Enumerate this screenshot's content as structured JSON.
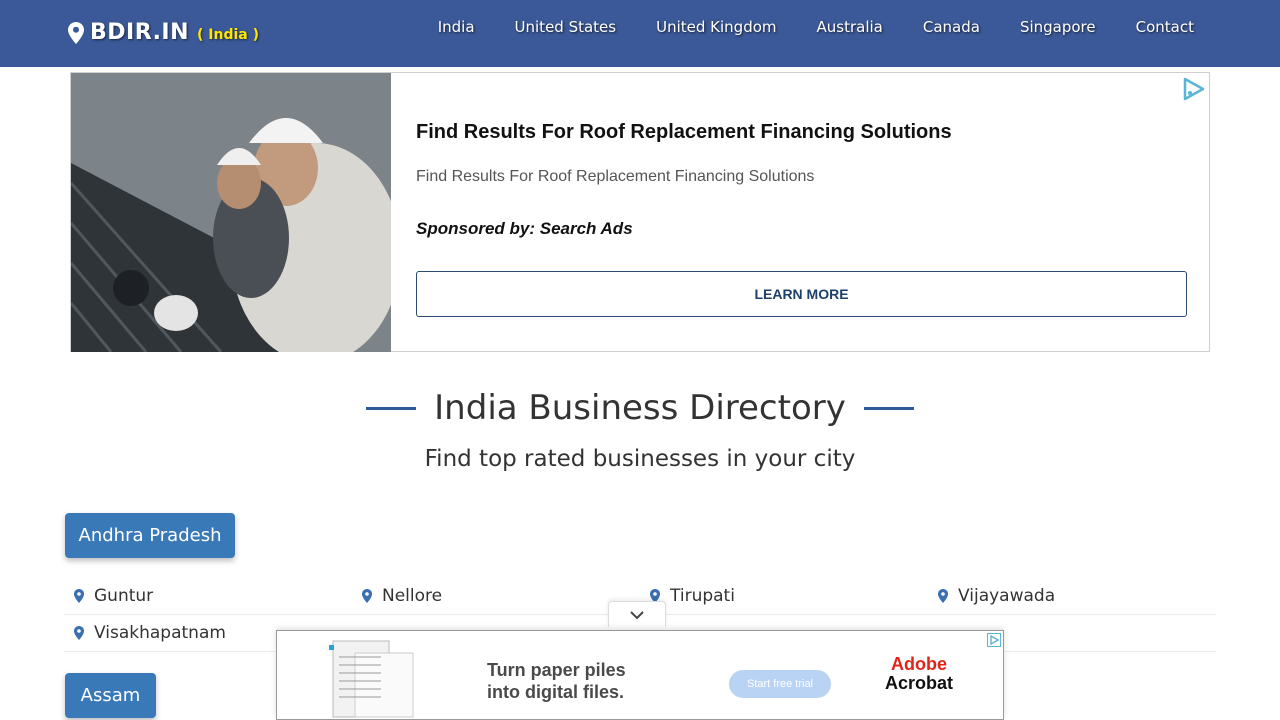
{
  "header": {
    "brand": "BDIR.IN",
    "country": "( India )",
    "nav": [
      "India",
      "United States",
      "United Kingdom",
      "Australia",
      "Canada",
      "Singapore",
      "Contact"
    ],
    "bg_color": "#3b5998"
  },
  "ad": {
    "title": "Find Results For Roof Replacement Financing Solutions",
    "description": "Find Results For Roof Replacement Financing Solutions",
    "sponsor": "Sponsored by: Search Ads",
    "cta": "LEARN MORE"
  },
  "main": {
    "heading": "India Business Directory",
    "subheading": "Find top rated businesses in your city",
    "states": [
      {
        "name": "Andhra Pradesh",
        "cities": [
          "Guntur",
          "Nellore",
          "Tirupati",
          "Vijayawada",
          "Visakhapatnam"
        ]
      },
      {
        "name": "Assam",
        "cities": []
      }
    ],
    "accent_color": "#3a79b8"
  },
  "bottom_ad": {
    "promo_line1": "Turn paper piles",
    "promo_line2": "into digital files.",
    "trial": "Start free trial",
    "brand_line1": "Adobe",
    "brand_line2": "Acrobat"
  }
}
